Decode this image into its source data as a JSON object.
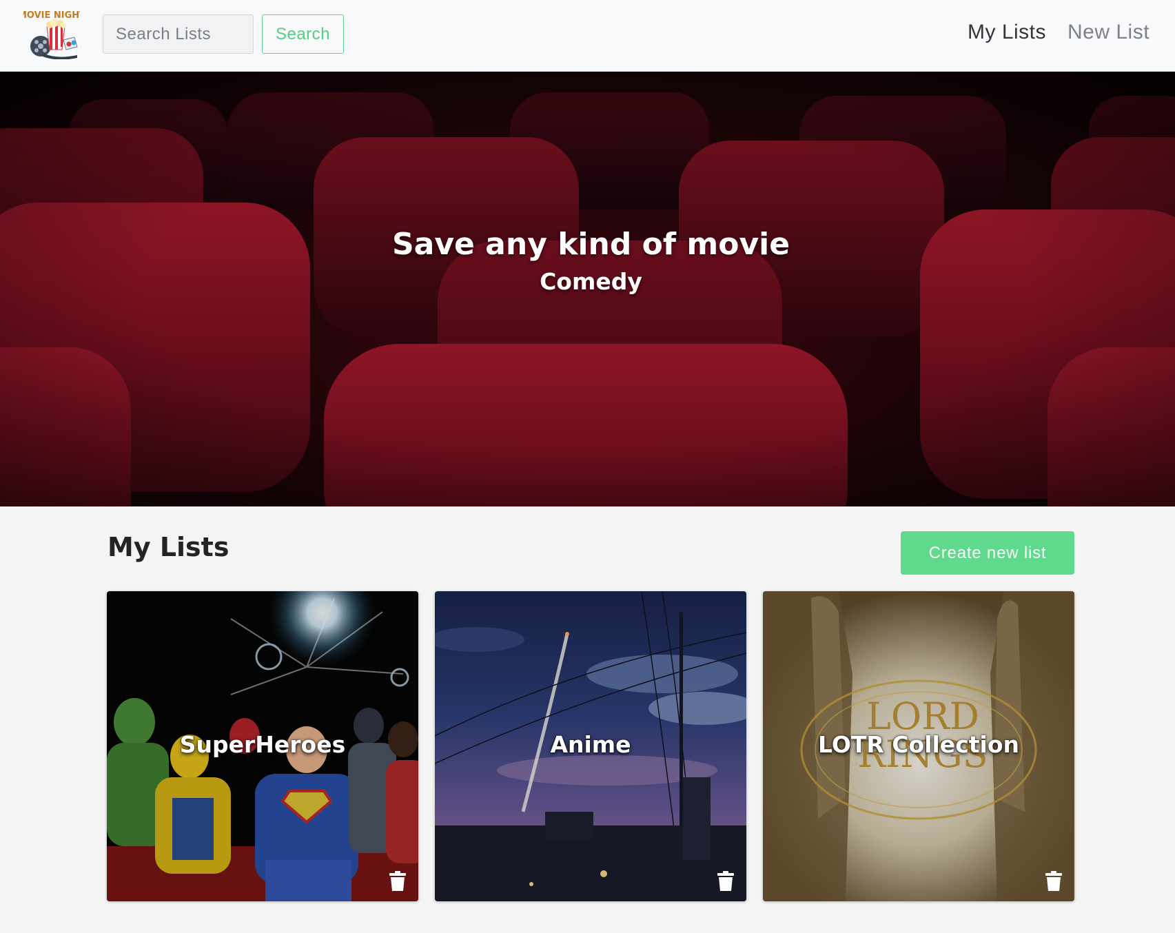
{
  "brand": {
    "logo_text": "MOVIE NIGHT"
  },
  "search": {
    "placeholder": "Search Lists",
    "value": "",
    "button_label": "Search"
  },
  "nav": {
    "my_lists": "My Lists",
    "new_list": "New List"
  },
  "hero": {
    "title": "Save any kind of movie",
    "subtitle": "Comedy"
  },
  "lists_section": {
    "title": "My Lists",
    "create_button": "Create new list",
    "cards": [
      {
        "title": "SuperHeroes",
        "icon": "trash-icon"
      },
      {
        "title": "Anime",
        "icon": "trash-icon"
      },
      {
        "title": "LOTR Collection",
        "icon": "trash-icon"
      }
    ]
  },
  "colors": {
    "accent_green": "#5fd98b",
    "navbar_bg": "#f8f9fa",
    "page_bg": "#f4f4f4",
    "hero_red": "#8a1022"
  }
}
